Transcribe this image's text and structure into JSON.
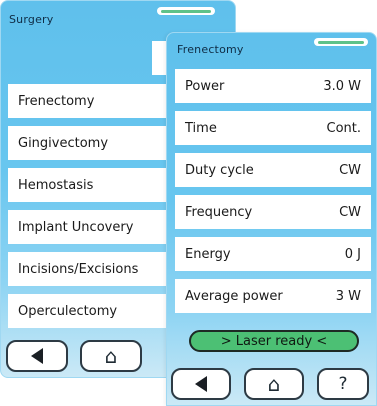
{
  "surgery_screen": {
    "title": "Surgery",
    "items": [
      {
        "label": "Frenectomy"
      },
      {
        "label": "Gingivectomy"
      },
      {
        "label": "Hemostasis"
      },
      {
        "label": "Implant Uncovery"
      },
      {
        "label": "Incisions/Excisions"
      },
      {
        "label": "Operculectomy"
      }
    ],
    "back_icon": "left-triangle-icon",
    "home_icon": "home-icon"
  },
  "frenectomy_screen": {
    "title": "Frenectomy",
    "params": [
      {
        "label": "Power",
        "value": "3.0 W"
      },
      {
        "label": "Time",
        "value": "Cont."
      },
      {
        "label": "Duty cycle",
        "value": "CW"
      },
      {
        "label": "Frequency",
        "value": "CW"
      },
      {
        "label": "Energy",
        "value": "0 J"
      },
      {
        "label": "Average power",
        "value": "3 W"
      }
    ],
    "status": "> Laser ready <",
    "help_label": "?",
    "back_icon": "left-triangle-icon",
    "home_icon": "home-icon"
  },
  "colors": {
    "screen_gradient_top": "#5fc0ec",
    "screen_gradient_bottom": "#cbe9f6",
    "status_green": "#4cc074",
    "tab_accent": "#5fc289"
  }
}
